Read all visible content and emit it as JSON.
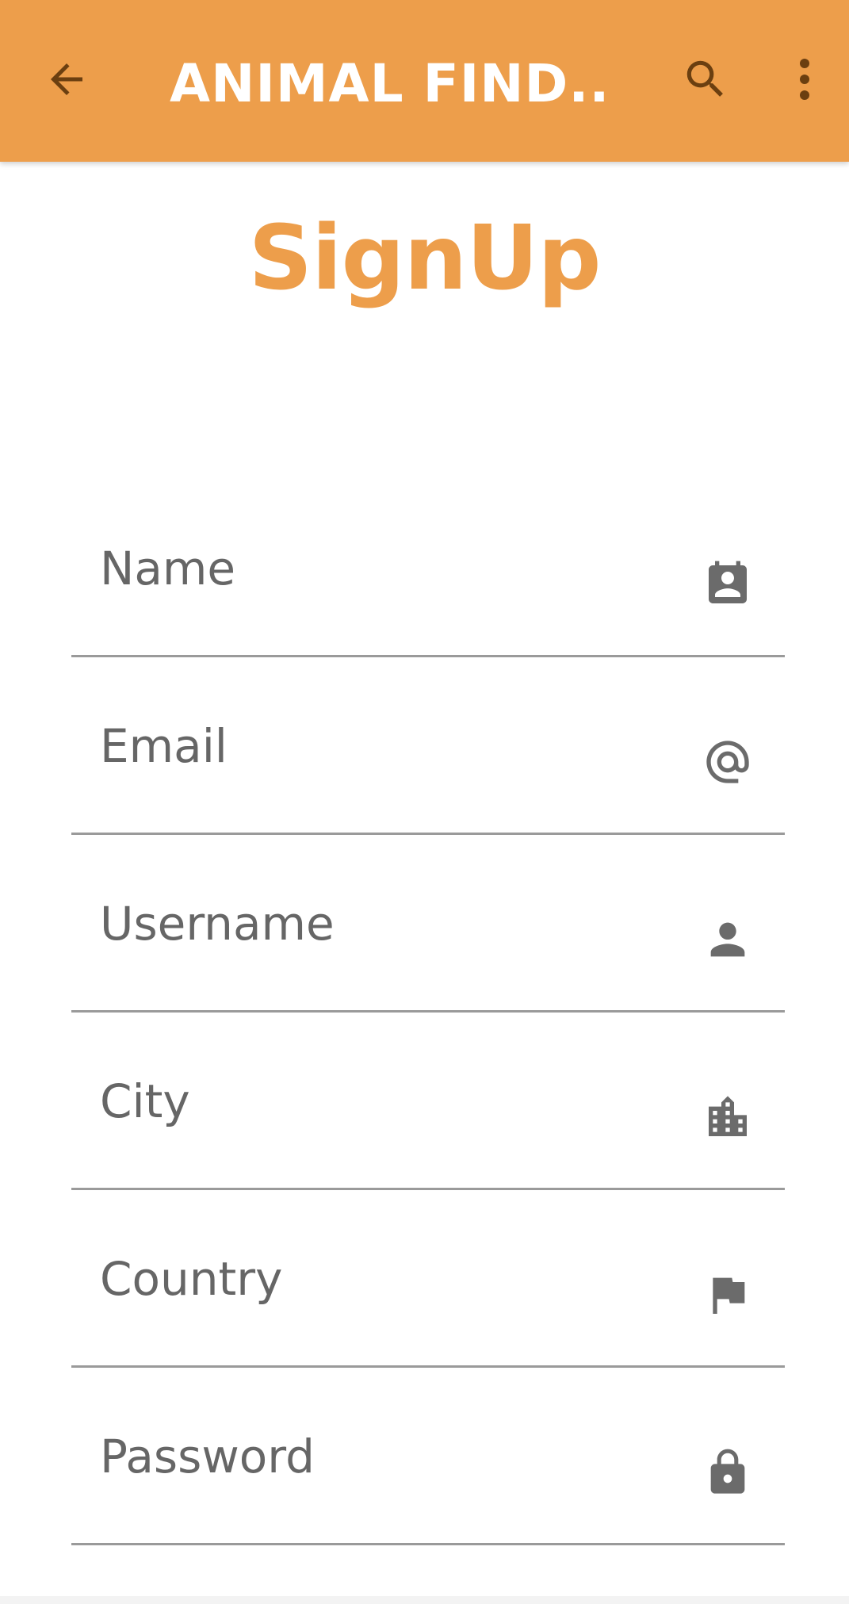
{
  "app_bar": {
    "title": "ANIMAL FIND...",
    "background_color": "#ed9e4b",
    "back_icon": "arrow-back-icon",
    "search_icon": "search-icon",
    "more_icon": "more-vert-icon"
  },
  "page": {
    "title": "SignUp",
    "title_color": "#ed9e4b"
  },
  "form": {
    "fields": [
      {
        "label": "Name",
        "icon": "contact-badge-icon"
      },
      {
        "label": "Email",
        "icon": "at-sign-icon"
      },
      {
        "label": "Username",
        "icon": "person-icon"
      },
      {
        "label": "City",
        "icon": "location-city-icon"
      },
      {
        "label": "Country",
        "icon": "flag-icon"
      },
      {
        "label": "Password",
        "icon": "lock-icon"
      }
    ]
  }
}
